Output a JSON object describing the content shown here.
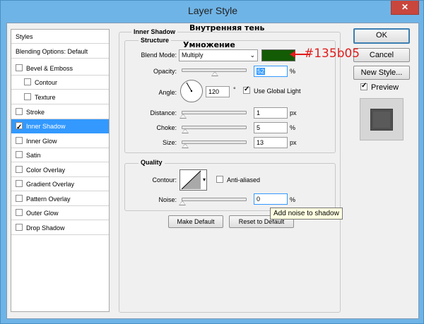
{
  "window": {
    "title": "Layer Style",
    "close_glyph": "✕"
  },
  "sidebar": {
    "items": [
      {
        "label": "Styles",
        "checkbox": false,
        "checked": false,
        "indent": false,
        "selected": false
      },
      {
        "label": "Blending Options: Default",
        "checkbox": false,
        "checked": false,
        "indent": false,
        "selected": false
      },
      {
        "label": "Bevel & Emboss",
        "checkbox": true,
        "checked": false,
        "indent": false,
        "selected": false
      },
      {
        "label": "Contour",
        "checkbox": true,
        "checked": false,
        "indent": true,
        "selected": false
      },
      {
        "label": "Texture",
        "checkbox": true,
        "checked": false,
        "indent": true,
        "selected": false
      },
      {
        "label": "Stroke",
        "checkbox": true,
        "checked": false,
        "indent": false,
        "selected": false
      },
      {
        "label": "Inner Shadow",
        "checkbox": true,
        "checked": true,
        "indent": false,
        "selected": true
      },
      {
        "label": "Inner Glow",
        "checkbox": true,
        "checked": false,
        "indent": false,
        "selected": false
      },
      {
        "label": "Satin",
        "checkbox": true,
        "checked": false,
        "indent": false,
        "selected": false
      },
      {
        "label": "Color Overlay",
        "checkbox": true,
        "checked": false,
        "indent": false,
        "selected": false
      },
      {
        "label": "Gradient Overlay",
        "checkbox": true,
        "checked": false,
        "indent": false,
        "selected": false
      },
      {
        "label": "Pattern Overlay",
        "checkbox": true,
        "checked": false,
        "indent": false,
        "selected": false
      },
      {
        "label": "Outer Glow",
        "checkbox": true,
        "checked": false,
        "indent": false,
        "selected": false
      },
      {
        "label": "Drop Shadow",
        "checkbox": true,
        "checked": false,
        "indent": false,
        "selected": false
      }
    ]
  },
  "panel": {
    "section_title": "Inner Shadow",
    "structure": {
      "legend": "Structure",
      "blend_mode_label": "Blend Mode:",
      "blend_mode_value": "Multiply",
      "shadow_color": "#135b05",
      "opacity_label": "Opacity:",
      "opacity_value": "52",
      "opacity_level": 0.52,
      "angle_label": "Angle:",
      "angle_value": "120",
      "angle_unit": "°",
      "global_light_label": "Use Global Light",
      "global_light_checked": true,
      "distance_label": "Distance:",
      "distance_value": "1",
      "distance_level": 0.01,
      "choke_label": "Choke:",
      "choke_value": "5",
      "choke_level": 0.05,
      "size_label": "Size:",
      "size_value": "13",
      "size_level": 0.05,
      "unit_px": "px",
      "unit_pct": "%"
    },
    "quality": {
      "legend": "Quality",
      "contour_label": "Contour:",
      "anti_aliased_label": "Anti-aliased",
      "noise_label": "Noise:",
      "noise_value": "0",
      "noise_level": 0.0
    },
    "make_default_label": "Make Default",
    "reset_default_label": "Reset to Default",
    "tooltip": "Add noise to shadow"
  },
  "actions": {
    "ok_label": "OK",
    "cancel_label": "Cancel",
    "new_style_label": "New Style...",
    "preview_label": "Preview",
    "preview_checked": true
  },
  "annotations": {
    "inner_shadow_ru": "Внутренняя тень",
    "multiply_ru": "Умножение",
    "color_hex": "#135b05",
    "arrow_color": "#e11b1b"
  }
}
